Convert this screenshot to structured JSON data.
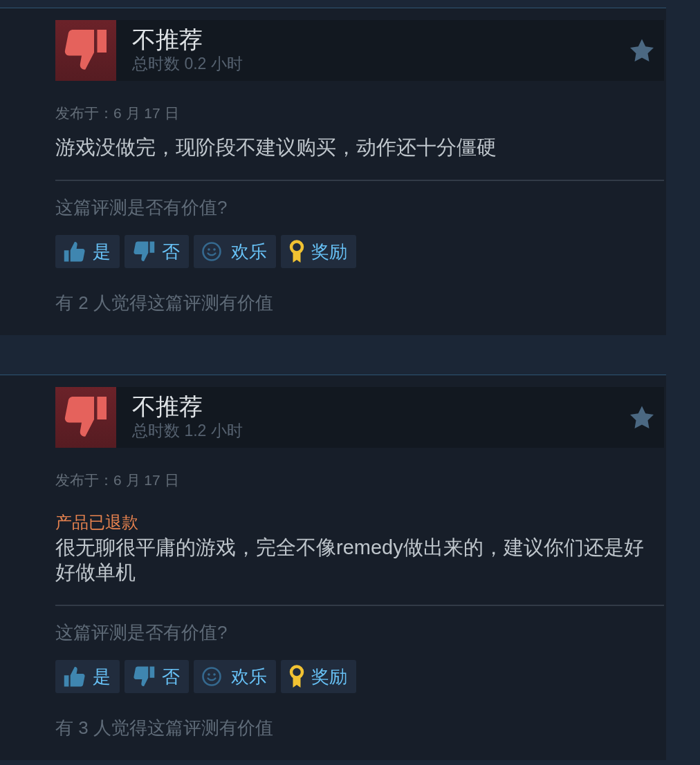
{
  "reviews": [
    {
      "recommended": false,
      "verdict": "不推荐",
      "playtime": "总时数 0.2 小时",
      "posted": "发布于：6 月 17 日",
      "text": "游戏没做完，现阶段不建议购买，动作还十分僵硬",
      "helpful_prompt": "这篇评测是否有价值?",
      "reactions": [
        {
          "kind": "yes",
          "label": "是"
        },
        {
          "kind": "no",
          "label": "否"
        },
        {
          "kind": "funny",
          "label": "欢乐"
        },
        {
          "kind": "award",
          "label": "奖励"
        }
      ],
      "helpful_count": "有 2 人觉得这篇评测有价值"
    },
    {
      "recommended": false,
      "verdict": "不推荐",
      "playtime": "总时数 1.2 小时",
      "posted": "发布于：6 月 17 日",
      "refund_note": "产品已退款",
      "text": "很无聊很平庸的游戏，完全不像remedy做出来的，建议你们还是好好做单机",
      "helpful_prompt": "这篇评测是否有价值?",
      "reactions": [
        {
          "kind": "yes",
          "label": "是"
        },
        {
          "kind": "no",
          "label": "否"
        },
        {
          "kind": "funny",
          "label": "欢乐"
        },
        {
          "kind": "award",
          "label": "奖励"
        }
      ],
      "helpful_count": "有 3 人觉得这篇评测有价值"
    }
  ]
}
